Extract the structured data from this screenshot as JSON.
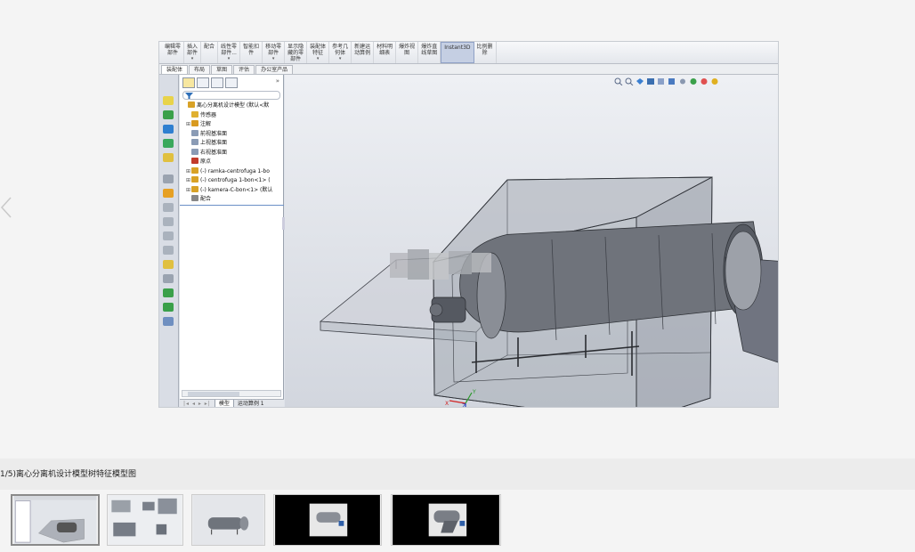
{
  "toolbar": {
    "commands": [
      {
        "label": "编辑零\n部件",
        "dropdown": false
      },
      {
        "label": "插入\n部件",
        "dropdown": true
      },
      {
        "label": "配合",
        "dropdown": false
      },
      {
        "label": "线性零\n部件...",
        "dropdown": true
      },
      {
        "label": "智能扣\n件",
        "dropdown": false
      },
      {
        "label": "移动零\n部件",
        "dropdown": true
      },
      {
        "label": "显示隐\n藏的零\n部件",
        "dropdown": false
      },
      {
        "label": "装配体\n特征",
        "dropdown": true
      },
      {
        "label": "参考几\n何体",
        "dropdown": true
      },
      {
        "label": "新建运\n动算例",
        "dropdown": false
      },
      {
        "label": "材料明\n细表",
        "dropdown": false
      },
      {
        "label": "爆炸视\n图",
        "dropdown": false
      },
      {
        "label": "爆炸直\n线草图",
        "dropdown": false
      },
      {
        "label": "Instant3D",
        "dropdown": false,
        "active": true
      },
      {
        "label": "比例删\n除",
        "dropdown": false
      }
    ],
    "tabs": [
      "装配体",
      "布局",
      "草图",
      "评估",
      "办公室产品"
    ]
  },
  "tree": {
    "expand_label": "»",
    "nodes": [
      {
        "label": "离心分离机设计模型  (默认<默",
        "indent": 0,
        "exp": "",
        "color": "#d8a227"
      },
      {
        "label": "传感器",
        "indent": 1,
        "exp": "",
        "color": "#e0b030"
      },
      {
        "label": "注解",
        "indent": 1,
        "exp": "⊞",
        "color": "#d89a20"
      },
      {
        "label": "前视基准面",
        "indent": 1,
        "exp": "",
        "color": "#8a9bb5"
      },
      {
        "label": "上视基准面",
        "indent": 1,
        "exp": "",
        "color": "#8a9bb5"
      },
      {
        "label": "右视基准面",
        "indent": 1,
        "exp": "",
        "color": "#8a9bb5"
      },
      {
        "label": "原点",
        "indent": 1,
        "exp": "",
        "color": "#c23b2b"
      },
      {
        "label": "(-) ramka-centrofuga 1-bo",
        "indent": 1,
        "exp": "⊞",
        "color": "#d8a227"
      },
      {
        "label": "(-) centrofuga 1-bon<1> (",
        "indent": 1,
        "exp": "⊞",
        "color": "#d8a227"
      },
      {
        "label": "(-) kamera-C-bon<1> (默认",
        "indent": 1,
        "exp": "⊞",
        "color": "#d8a227"
      },
      {
        "label": "配合",
        "indent": 1,
        "exp": "",
        "color": "#888888"
      }
    ],
    "bottom_tabs": {
      "nav": "|◂ ◂ ▸ ▸|",
      "model": "模型",
      "motion": "运动算例 1"
    }
  },
  "viewport": {
    "axis_x": "X",
    "axis_y": "Y",
    "axis_z": "Z"
  },
  "caption": "1/5)离心分离机设计模型树特征模型图",
  "thumbnails": [
    {
      "name": "thumb-1",
      "active": true
    },
    {
      "name": "thumb-2",
      "active": false
    },
    {
      "name": "thumb-3",
      "active": false
    },
    {
      "name": "thumb-4",
      "active": false
    },
    {
      "name": "thumb-5",
      "active": false
    }
  ],
  "colors": {
    "accent": "#6b8fc6",
    "background": "#f4f4f4",
    "viewport": "#dfe3ea"
  }
}
